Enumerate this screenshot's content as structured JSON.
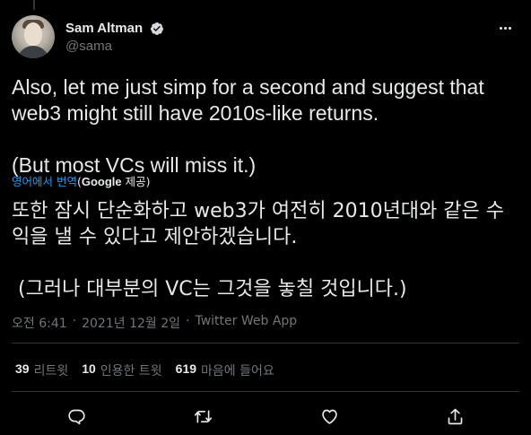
{
  "author": {
    "display_name": "Sam Altman",
    "handle": "@sama",
    "verified": true
  },
  "tweet": {
    "text": "Also, let me just simp for a second and suggest that web3 might still have 2010s-like returns.\n\n(But most VCs will miss it.)",
    "translate_link": "영어에서 번역",
    "translate_provider_prefix": "(",
    "translate_provider_brand": "Google",
    "translate_provider_suffix": " 제공)",
    "translated_text": "또한 잠시 단순화하고 web3가 여전히 2010년대와 같은 수익을 낼 수 있다고 제안하겠습니다.\n\n (그러나 대부분의 VC는 그것을 놓칠 것입니다.)",
    "time": "오전 6:41",
    "date": "2021년 12월 2일",
    "source": "Twitter Web App",
    "separator": "·"
  },
  "stats": {
    "retweets_count": "39",
    "retweets_label": "리트윗",
    "quotes_count": "10",
    "quotes_label": "인용한 트윗",
    "likes_count": "619",
    "likes_label": "마음에 들어요"
  },
  "icons": {
    "more": "more-horizontal-icon",
    "verified": "verified-badge-icon",
    "reply": "reply-icon",
    "retweet": "retweet-icon",
    "like": "heart-icon",
    "share": "share-icon"
  },
  "colors": {
    "background": "#000000",
    "text": "#e7e9ea",
    "secondary": "#71767b",
    "accent": "#1d9bf0",
    "divider": "#2f3336"
  }
}
